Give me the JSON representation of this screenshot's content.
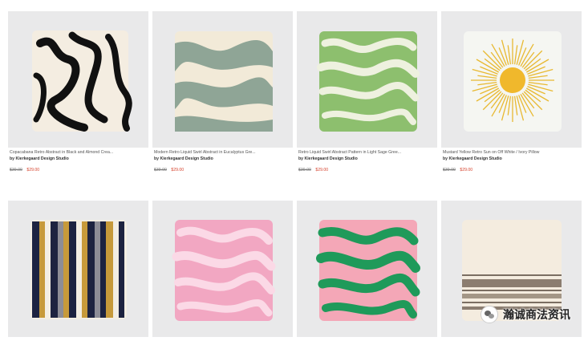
{
  "products": [
    {
      "title": "Copacabana Retro Abstract in Black and Almond Crea...",
      "artist": "by Kierkegaard Design Studio",
      "old_price": "$39.00",
      "new_price": "$29.00"
    },
    {
      "title": "Modern Retro Liquid Swirl Abstract in Eucalyptus Gre...",
      "artist": "by Kierkegaard Design Studio",
      "old_price": "$39.00",
      "new_price": "$29.00"
    },
    {
      "title": "Retro Liquid Swirl Abstract Pattern in Light Sage Gree...",
      "artist": "by Kierkegaard Design Studio",
      "old_price": "$39.00",
      "new_price": "$29.00"
    },
    {
      "title": "Mustard Yellow Retro Sun on Off White / Ivory Pillow",
      "artist": "by Kierkegaard Design Studio",
      "old_price": "$39.00",
      "new_price": "$29.00"
    },
    {
      "title": "",
      "artist": "",
      "old_price": "",
      "new_price": ""
    },
    {
      "title": "",
      "artist": "",
      "old_price": "",
      "new_price": ""
    },
    {
      "title": "",
      "artist": "",
      "old_price": "",
      "new_price": ""
    },
    {
      "title": "",
      "artist": "",
      "old_price": "",
      "new_price": ""
    }
  ],
  "watermark": {
    "text": "瀚诚商法资讯"
  },
  "colors": {
    "tile_bg": "#e9e9ea",
    "sale_price": "#d6432e"
  }
}
